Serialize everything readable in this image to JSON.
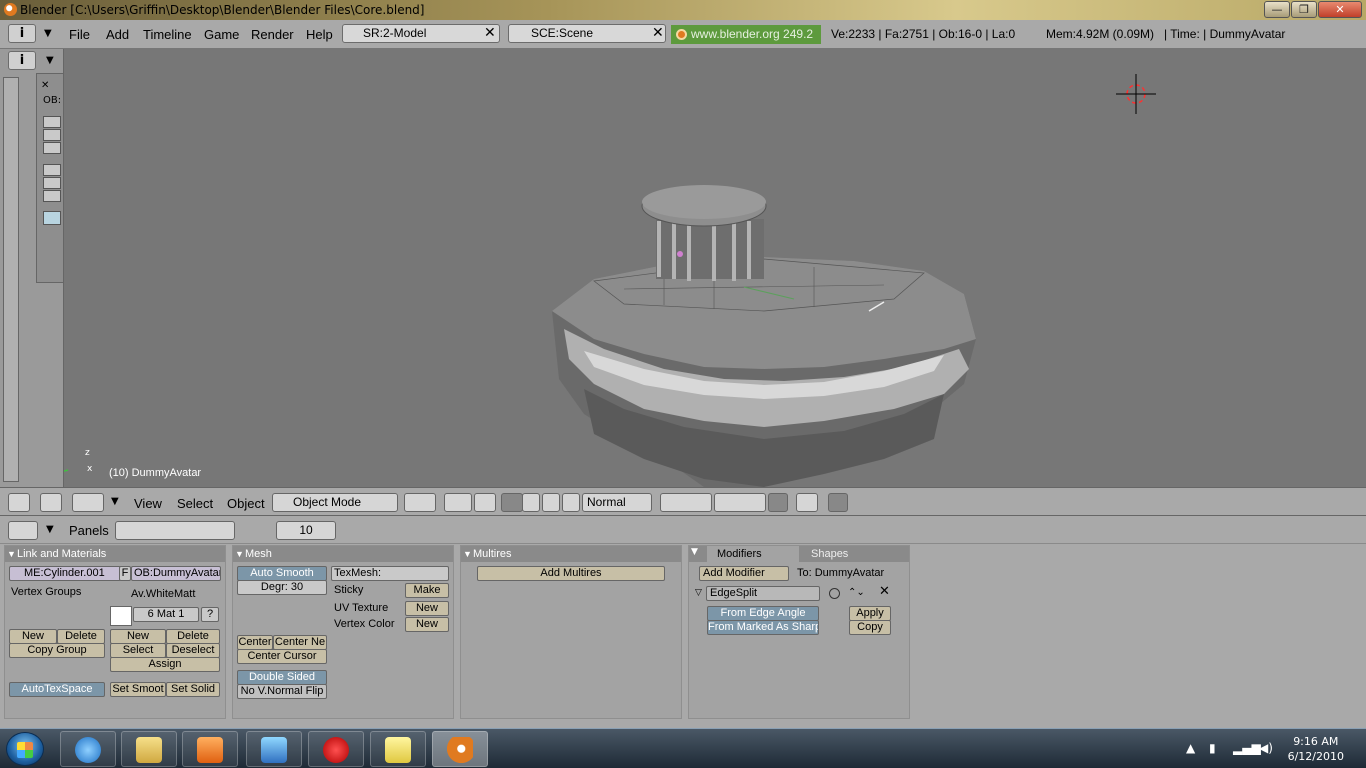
{
  "window": {
    "title": "Blender [C:\\Users\\Griffin\\Desktop\\Blender\\Blender Files\\Core.blend]",
    "minimize": "—",
    "maximize": "❐",
    "close": "✕"
  },
  "topheader": {
    "menus": [
      "File",
      "Add",
      "Timeline",
      "Game",
      "Render",
      "Help"
    ],
    "screen": "SR:2-Model",
    "scene": "SCE:Scene",
    "website": "www.blender.org 249.2",
    "stats": "Ve:2233 | Fa:2751 | Ob:16-0 | La:0",
    "mem": "Mem:4.92M (0.09M)",
    "time": "| Time: | DummyAvatar",
    "x": "✕"
  },
  "viewport": {
    "object_label": "(10) DummyAvatar",
    "axis_z": "z",
    "axis_x": "x",
    "left_obfield": "OB:"
  },
  "view_header": {
    "menus": [
      "View",
      "Select",
      "Object"
    ],
    "mode": "Object Mode",
    "orientation": "Normal"
  },
  "buttons_header": {
    "panels_label": "Panels",
    "frame": "10"
  },
  "link_materials": {
    "title": "Link and Materials",
    "mesh_name": "ME:Cylinder.001",
    "f_btn": "F",
    "ob_name": "OB:DummyAvatar",
    "vertex_groups": "Vertex Groups",
    "material_name": "Av.WhiteMatt",
    "mat_index": "6 Mat 1",
    "question": "?",
    "vg_new": "New",
    "vg_delete": "Delete",
    "copy_group": "Copy Group",
    "mat_new": "New",
    "mat_delete": "Delete",
    "mat_select": "Select",
    "mat_deselect": "Deselect",
    "assign": "Assign",
    "autotexspace": "AutoTexSpace",
    "set_smooth": "Set Smoot",
    "set_solid": "Set Solid"
  },
  "mesh": {
    "title": "Mesh",
    "auto_smooth": "Auto Smooth",
    "degr": "Degr: 30",
    "texmesh": "TexMesh:",
    "sticky": "Sticky",
    "make": "Make",
    "uv_texture": "UV Texture",
    "uv_new": "New",
    "vertex_color": "Vertex Color",
    "vc_new": "New",
    "center": "Center",
    "center_new": "Center Ne",
    "center_cursor": "Center Cursor",
    "double_sided": "Double Sided",
    "no_vnormal_flip": "No V.Normal Flip"
  },
  "multires": {
    "title": "Multires",
    "add_multires": "Add Multires"
  },
  "modifiers": {
    "tab_modifiers": "Modifiers",
    "tab_shapes": "Shapes",
    "add_modifier": "Add Modifier",
    "to": "To: DummyAvatar",
    "modifier_name": "EdgeSplit",
    "from_edge_angle": "From Edge Angle",
    "from_marked_sharp": "From Marked As Sharp",
    "apply": "Apply",
    "copy": "Copy"
  },
  "taskbar": {
    "time": "9:16 AM",
    "date": "6/12/2010"
  },
  "colors": {
    "viewport_bg": "#777777",
    "panel_bg": "#a9a9a9",
    "green_label": "#5d9a3d",
    "blue_button": "#7c96a8"
  }
}
